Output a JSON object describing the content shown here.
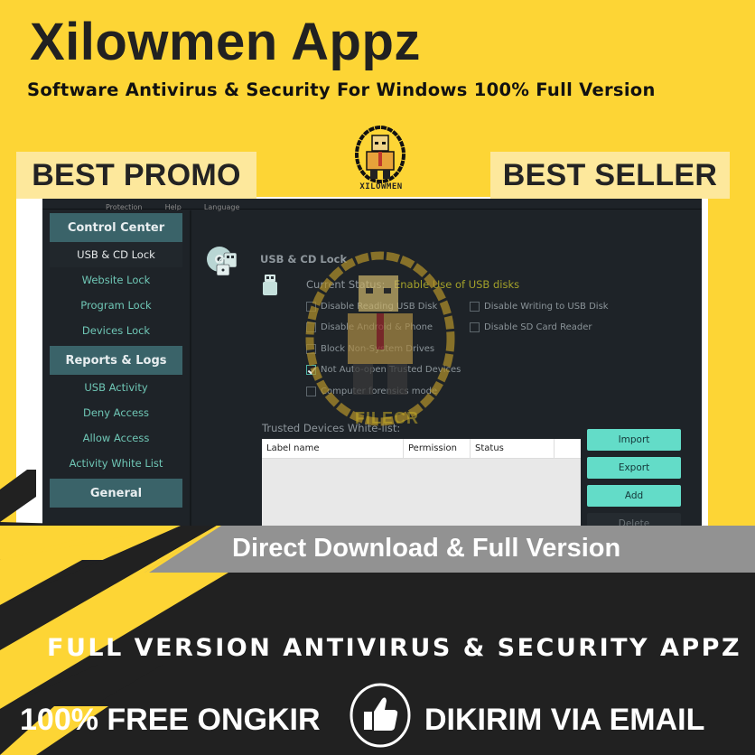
{
  "header": {
    "title": "Xilowmen Appz",
    "subtitle": "Software Antivirus & Security For Windows 100% Full Version",
    "badge_left": "BEST PROMO",
    "badge_right": "BEST SELLER",
    "logo_text": "XILOWMEN"
  },
  "app": {
    "menubar": [
      "Protection",
      "Help",
      "Language"
    ],
    "sidebar": {
      "sections": [
        {
          "title": "Control Center",
          "items": [
            {
              "label": "USB & CD Lock",
              "active": true
            },
            {
              "label": "Website Lock",
              "active": false
            },
            {
              "label": "Program Lock",
              "active": false
            },
            {
              "label": "Devices Lock",
              "active": false
            }
          ]
        },
        {
          "title": "Reports & Logs",
          "items": [
            {
              "label": "USB Activity",
              "active": false
            },
            {
              "label": "Deny Access",
              "active": false
            },
            {
              "label": "Allow Access",
              "active": false
            },
            {
              "label": "Activity White List",
              "active": false
            }
          ]
        },
        {
          "title": "General",
          "items": []
        }
      ]
    },
    "main": {
      "page_title": "USB & CD Lock",
      "status_label": "Current Status:",
      "status_value": "Enable Use of USB disks",
      "options": [
        {
          "label": "Disable Reading USB Disk",
          "checked": false
        },
        {
          "label": "Disable Android & Phone",
          "checked": false
        },
        {
          "label": "Block Non-System Drives",
          "checked": false
        },
        {
          "label": "Not Auto-open Trusted Devices",
          "checked": true
        },
        {
          "label": "Computer forensics mode",
          "checked": false
        },
        {
          "label": "Disable Writing to USB Disk",
          "checked": false
        },
        {
          "label": "Disable SD Card Reader",
          "checked": false
        }
      ],
      "whitelist_label": "Trusted Devices White-list:",
      "table": {
        "columns": [
          "Label name",
          "Permission",
          "Status",
          ""
        ],
        "rows": []
      },
      "buttons": {
        "import": "Import",
        "export": "Export",
        "add": "Add",
        "delete": "Delete"
      }
    }
  },
  "watermark": "FILECR",
  "footer": {
    "banner": "Direct Download & Full Version",
    "title": "FULL VERSION ANTIVIRUS & SECURITY APPZ",
    "left": "100% FREE ONGKIR",
    "right": "DIKIRIM VIA EMAIL"
  },
  "colors": {
    "brand_yellow": "#fdd535",
    "badge_bg": "#fde89c",
    "dark_bg": "#212121",
    "banner_gray": "#929292",
    "app_bg": "#1e2328",
    "section_head": "#3a6369",
    "sidebar_link": "#6fc7b6",
    "button_teal": "#63dcc8",
    "status_yellow": "#a3a12a"
  }
}
